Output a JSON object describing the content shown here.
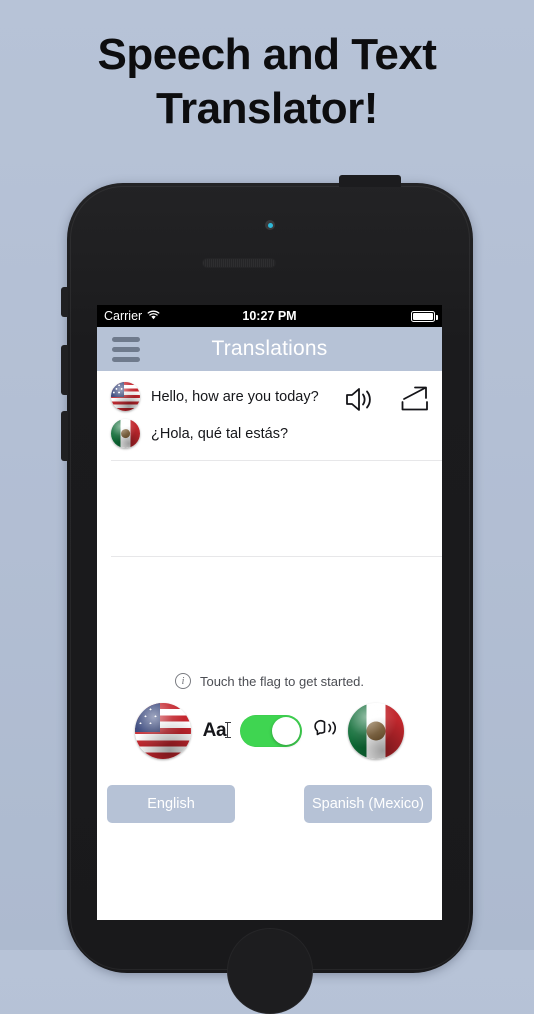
{
  "headline": {
    "line1": "Speech and Text",
    "line2": "Translator!"
  },
  "status_bar": {
    "carrier": "Carrier",
    "time": "10:27 PM",
    "wifi_icon": "wifi-icon",
    "battery_icon": "battery-full-icon"
  },
  "navbar": {
    "menu_icon": "hamburger-menu-icon",
    "title": "Translations"
  },
  "conversation": {
    "rows": [
      {
        "flag": "flag-united-states",
        "text": "Hello, how are you today?"
      },
      {
        "flag": "flag-mexico",
        "text": "¿Hola, qué tal estás?"
      }
    ],
    "actions": {
      "speaker_icon": "speaker-icon",
      "share_icon": "share-icon"
    }
  },
  "hint": {
    "icon": "info-icon",
    "text": "Touch the flag to get started."
  },
  "controls": {
    "source_flag": "flag-united-states",
    "target_flag": "flag-mexico",
    "text_mode_label": "Aa",
    "text_mode_icon": "text-cursor-icon",
    "toggle": {
      "name": "speech-text-toggle",
      "state": "on",
      "color": "#3fd551"
    },
    "speech_icon": "speaking-head-icon"
  },
  "languages": {
    "source": "English",
    "target": "Spanish (Mexico)",
    "button_color": "#b6c2d6"
  },
  "device": {
    "camera_icon": "front-camera-icon",
    "earpiece_icon": "earpiece-speaker-icon",
    "home_button": "home-button",
    "power_button": "power-button",
    "mute_switch": "mute-switch",
    "volume_up": "volume-up-button",
    "volume_down": "volume-down-button"
  }
}
